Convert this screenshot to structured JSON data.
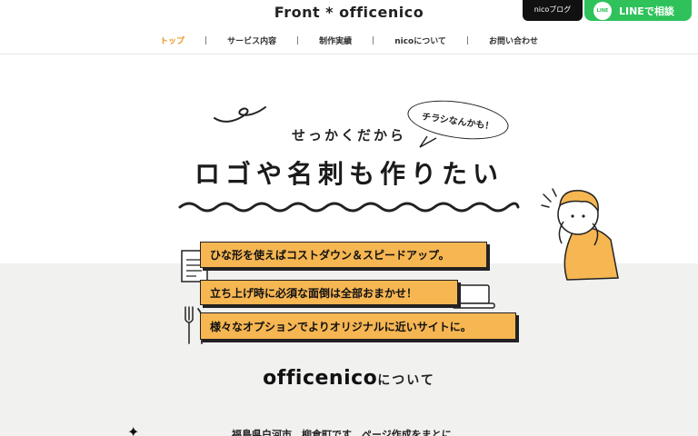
{
  "header": {
    "logo": "Front * officenico",
    "nav": [
      {
        "label": "トップ",
        "active": true
      },
      {
        "label": "サービス内容",
        "active": false
      },
      {
        "label": "制作実績",
        "active": false
      },
      {
        "label": "nicoについて",
        "active": false
      },
      {
        "label": "お問い合わせ",
        "active": false
      }
    ],
    "nav_separator": "|",
    "blog_button": "nicoブログ",
    "line_button": "LINEで相談",
    "line_icon": "LINE"
  },
  "hero": {
    "bubble": "チラシなんかも！",
    "subheading": "せっかくだから",
    "heading": "ロゴや名刺も作りたい",
    "banners": [
      "ひな形を使えばコストダウン＆スピードアップ。",
      "立ち上げ時に必須な面倒は全部おまかせ！",
      "様々なオプションでよりオリジナルに近いサイトに。"
    ]
  },
  "about": {
    "brand": "officenico",
    "suffix": "について",
    "text_partial": "福島県白河市　柳倉町です　ページ作成をまとに"
  },
  "colors": {
    "accent": "#f6b652",
    "nav_active": "#e8961e",
    "line_green": "#2fc25b",
    "gray_bg": "#f1f1f0"
  }
}
